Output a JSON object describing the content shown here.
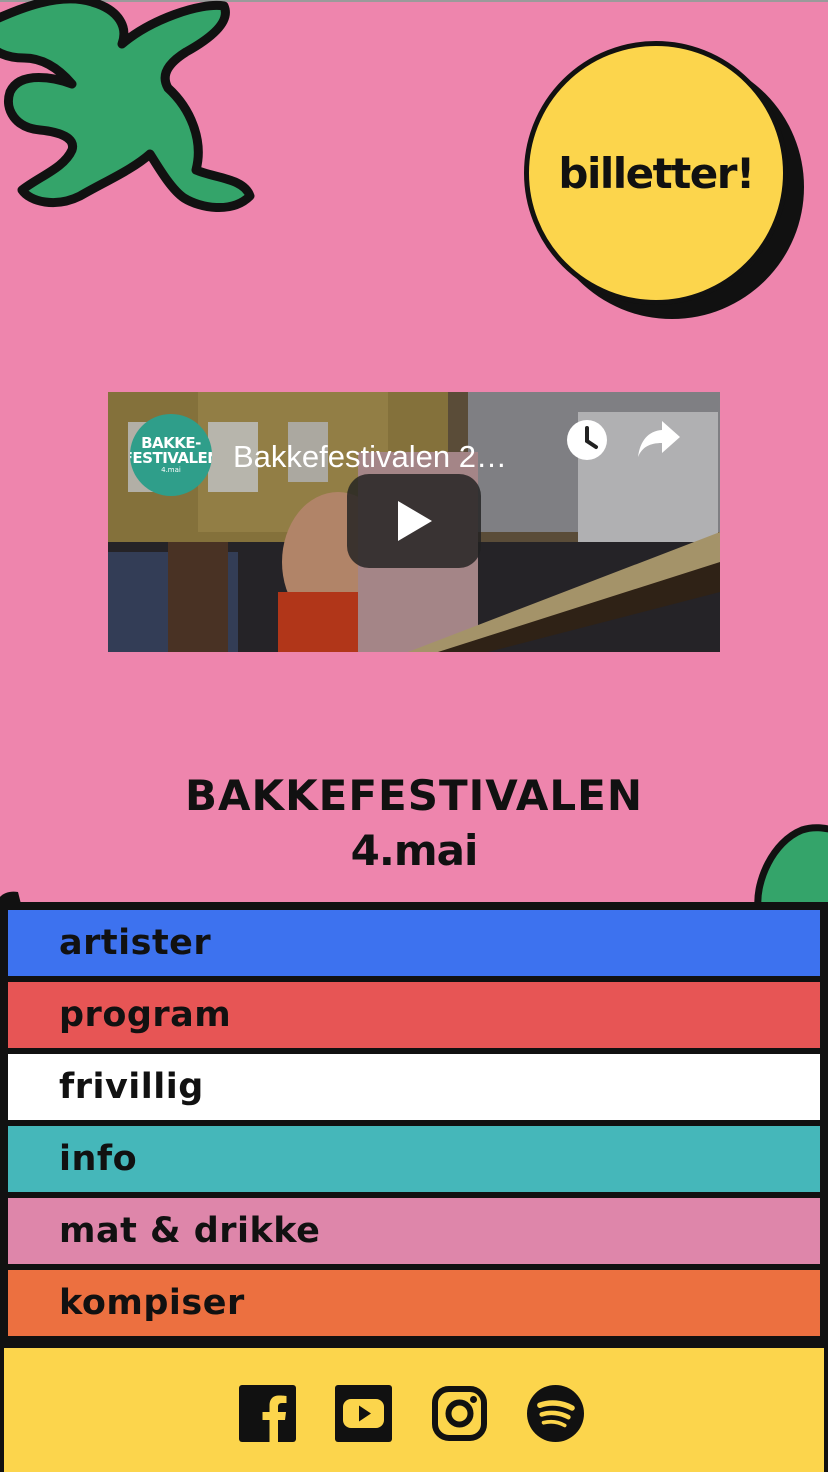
{
  "header": {
    "ticket_button_label": "billetter!"
  },
  "video": {
    "channel_logo_line1": "BAKKE-",
    "channel_logo_line2": "FESTIVALEN",
    "channel_logo_line3": "4.mai",
    "title": "Bakkefestivalen 2…",
    "icons": [
      "watch-later-icon",
      "share-icon",
      "play-icon"
    ]
  },
  "event": {
    "name": "BAKKEFESTIVALEN",
    "date": "4.mai"
  },
  "nav": {
    "items": [
      {
        "label": "artister",
        "color": "#3d72ef"
      },
      {
        "label": "program",
        "color": "#e75555"
      },
      {
        "label": "frivillig",
        "color": "#ffffff"
      },
      {
        "label": "info",
        "color": "#45b7ba"
      },
      {
        "label": "mat & drikke",
        "color": "#de86aa"
      },
      {
        "label": "kompiser",
        "color": "#ec7040"
      }
    ]
  },
  "footer": {
    "social_icons": [
      "facebook-icon",
      "youtube-icon",
      "instagram-icon",
      "spotify-icon"
    ]
  },
  "colors": {
    "page_background": "#ee85ad",
    "ticket_yellow": "#fcd54c",
    "leaf_green": "#34a46a",
    "outline": "#111111"
  }
}
